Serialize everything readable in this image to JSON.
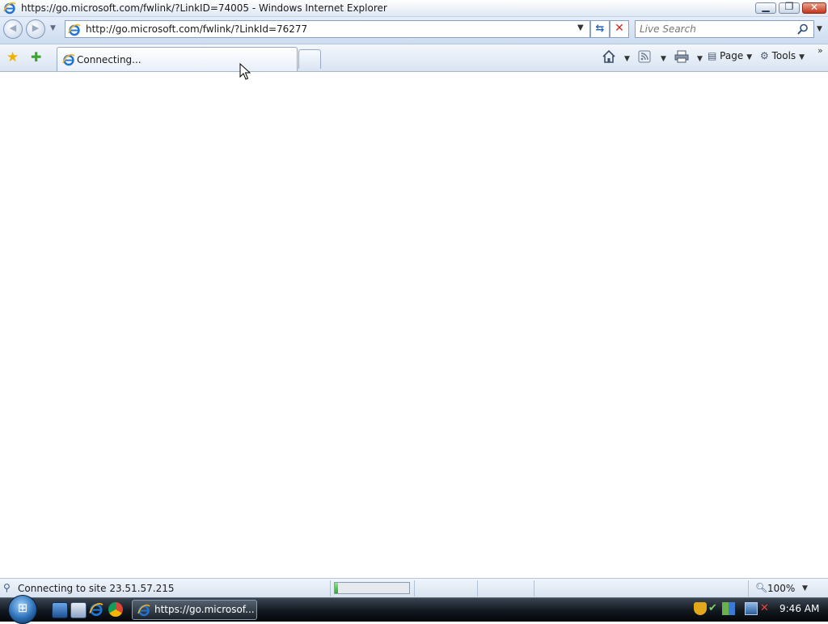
{
  "window": {
    "title": "https://go.microsoft.com/fwlink/?LinkID=74005 - Windows Internet Explorer",
    "min_icon": "minimize-icon",
    "max_icon": "restore-icon",
    "close_icon": "close-icon"
  },
  "navbar": {
    "back_icon": "back-arrow-icon",
    "forward_icon": "forward-arrow-icon",
    "address": "http://go.microsoft.com/fwlink/?LinkId=76277",
    "search_placeholder": "Live Search",
    "refresh_icon": "refresh-icon",
    "stop_icon": "stop-icon"
  },
  "tabs": [
    {
      "label": "Connecting...",
      "active": true
    }
  ],
  "commandbar": {
    "home_icon": "home-icon",
    "feeds_icon": "rss-feed-icon",
    "print_icon": "printer-icon",
    "page_label": "Page",
    "tools_label": "Tools"
  },
  "status": {
    "text": "Connecting to site 23.51.57.215",
    "progress": 0.04,
    "zoom": "100%"
  },
  "taskbar": {
    "task_label": "https://go.microsof...",
    "clock": "9:46 AM"
  },
  "colors": {
    "accent": "#2a68b5",
    "progress": "#2da52b",
    "close": "#c3351c"
  }
}
